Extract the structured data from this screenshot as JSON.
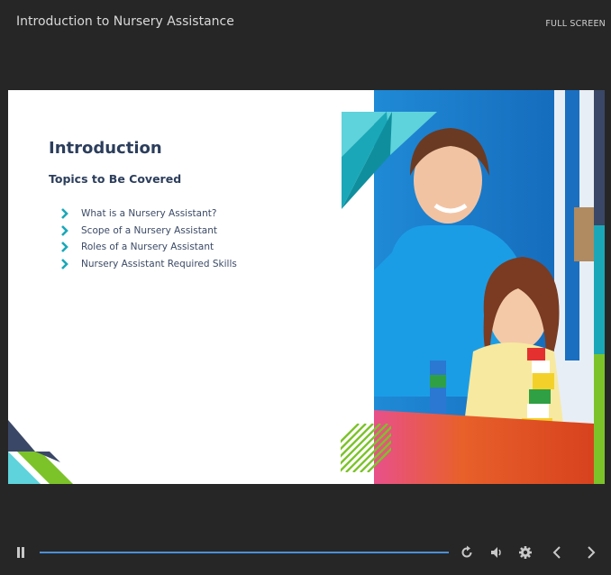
{
  "header": {
    "title": "Introduction to Nursery Assistance",
    "fullscreen_label": "FULL SCREEN"
  },
  "slide": {
    "heading": "Introduction",
    "subheading": "Topics to Be Covered",
    "topics": [
      "What is a Nursery Assistant?",
      "Scope of a Nursery Assistant",
      "Roles of a Nursery Assistant",
      "Nursery Assistant Required Skills"
    ],
    "photo_description_icon": "photo-icon"
  },
  "controls": {
    "progress": 1.0,
    "icons": [
      "pause-icon",
      "replay-icon",
      "volume-icon",
      "settings-icon",
      "previous-icon",
      "next-icon"
    ]
  },
  "colors": {
    "background": "#262626",
    "heading": "#2c3e5c",
    "accent_teal": "#1aa8b8",
    "accent_green": "#7cc32a",
    "accent_navy": "#3a4766",
    "progress": "#4a90d9"
  }
}
